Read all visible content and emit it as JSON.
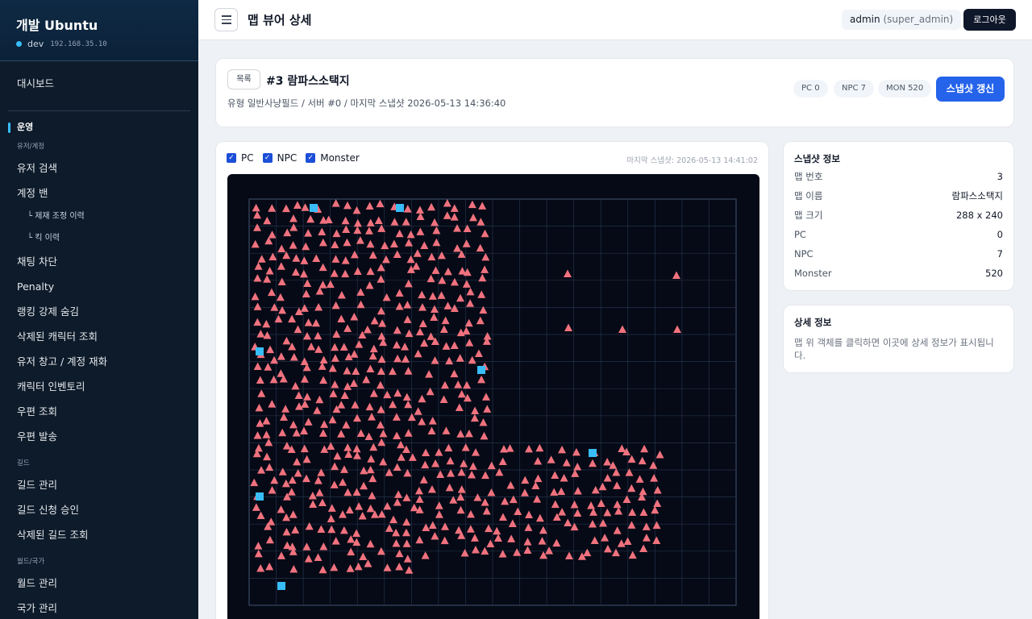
{
  "sidebar": {
    "brand_title": "개발 Ubuntu",
    "env": "dev",
    "ip": "192.168.35.10",
    "dashboard": "대시보드",
    "section_operation": "운영",
    "group_user": "유저/계정",
    "user_search": "유저 검색",
    "account_ban": "계정 밴",
    "sanction_history": "└ 제재 조정 이력",
    "kick_history": "└ 킥 이력",
    "chat_block": "채팅 차단",
    "penalty": "Penalty",
    "ranking_hide": "랭킹 강제 숨김",
    "deleted_char": "삭제된 캐릭터 조회",
    "user_storage": "유저 창고 / 계정 재화",
    "char_inventory": "캐릭터 인벤토리",
    "mail_search": "우편 조회",
    "mail_send": "우편 발송",
    "group_guild": "길드",
    "guild_manage": "길드 관리",
    "guild_approve": "길드 신청 승인",
    "deleted_guild": "삭제된 길드 조회",
    "group_world": "월드/국가",
    "world_manage": "월드 관리",
    "nation_manage": "국가 관리"
  },
  "topbar": {
    "title": "맵 뷰어 상세",
    "user": "admin",
    "role": "(super_admin)",
    "logout": "로그아웃"
  },
  "header": {
    "list_button": "목록",
    "map_title": "#3 람파스소택지",
    "meta": "유형 일반사냥필드 / 서버 #0 / 마지막 스냅샷 2026-05-13 14:36:40",
    "chip_pc": "PC 0",
    "chip_npc": "NPC 7",
    "chip_mon": "MON 520",
    "refresh": "스냅샷 갱신"
  },
  "map": {
    "filter_pc": "PC",
    "filter_npc": "NPC",
    "filter_monster": "Monster",
    "snapshot_label": "마지막 스냅샷: 2026-05-13 14:41:02",
    "colors": {
      "background": "#050a16",
      "grid": "#24324a",
      "monster": "#f0727e",
      "npc": "#38bdf8"
    }
  },
  "snapshot_info": {
    "title": "스냅샷 정보",
    "rows": [
      {
        "k": "맵 번호",
        "v": "3"
      },
      {
        "k": "맵 이름",
        "v": "람파스소택지"
      },
      {
        "k": "맵 크기",
        "v": "288 x 240"
      },
      {
        "k": "PC",
        "v": "0"
      },
      {
        "k": "NPC",
        "v": "7"
      },
      {
        "k": "Monster",
        "v": "520"
      }
    ]
  },
  "detail_info": {
    "title": "상세 정보",
    "text": "맵 위 객체를 클릭하면 이곳에 상세 정보가 표시됩니다."
  }
}
